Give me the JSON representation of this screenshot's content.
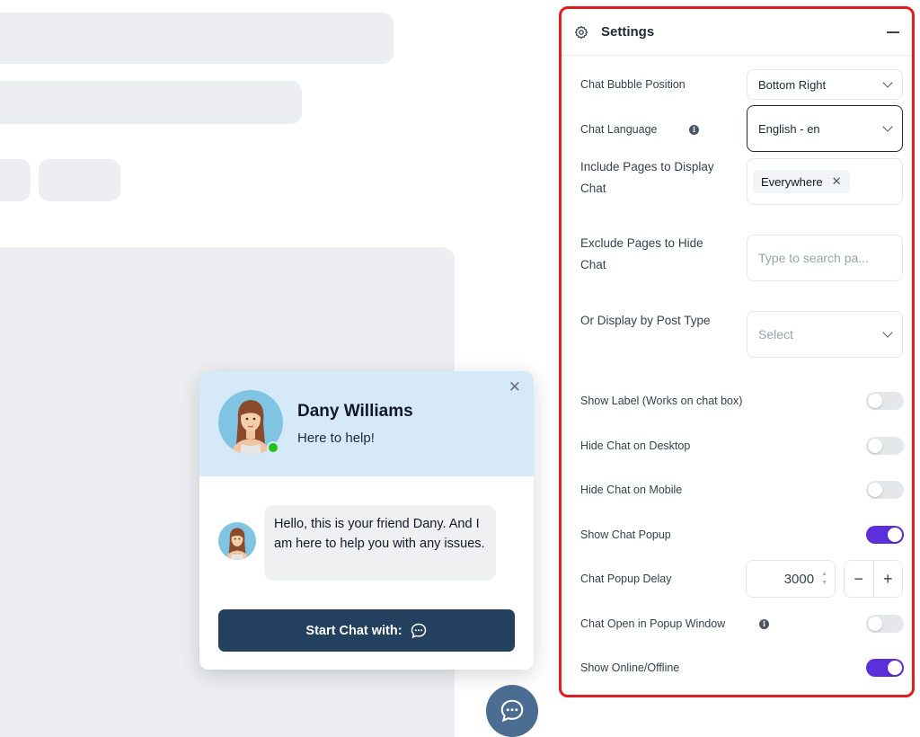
{
  "widget": {
    "name": "Dany Williams",
    "subtitle": "Here to help!",
    "close_glyph": "✕",
    "message": "Hello, this is your friend Dany. And I am here to help you with any issues.",
    "start_label": "Start Chat with:",
    "online_color": "#22c31a",
    "header_color": "#d6e9f8",
    "button_color": "#23405f",
    "icons": [
      "close-icon",
      "chat-bubble-icon",
      "online-status-dot"
    ]
  },
  "settings": {
    "title": "Settings",
    "rows": {
      "bubble_position": {
        "label": "Chat Bubble Position",
        "value": "Bottom Right"
      },
      "language": {
        "label": "Chat Language",
        "value": "English - en"
      },
      "include_pages": {
        "label": "Include Pages to Display Chat",
        "tag": "Everywhere",
        "tag_close": "✕"
      },
      "exclude_pages": {
        "label": "Exclude Pages to Hide Chat",
        "placeholder": "Type to search pa..."
      },
      "post_type": {
        "label": "Or Display by Post Type",
        "placeholder": "Select"
      },
      "show_label": {
        "label": "Show Label (Works on chat box)",
        "on": false
      },
      "hide_desktop": {
        "label": "Hide Chat on Desktop",
        "on": false
      },
      "hide_mobile": {
        "label": "Hide Chat on Mobile",
        "on": false
      },
      "show_popup": {
        "label": "Show Chat Popup",
        "on": true
      },
      "popup_delay": {
        "label": "Chat Popup Delay",
        "value": "3000",
        "minus": "−",
        "plus": "+"
      },
      "popup_window": {
        "label": "Chat Open in Popup Window",
        "on": false
      },
      "online_offline": {
        "label": "Show Online/Offline",
        "on": true
      }
    },
    "toggle_on_color": "#5b2fd9",
    "highlight_border_color": "#e11d1d"
  }
}
